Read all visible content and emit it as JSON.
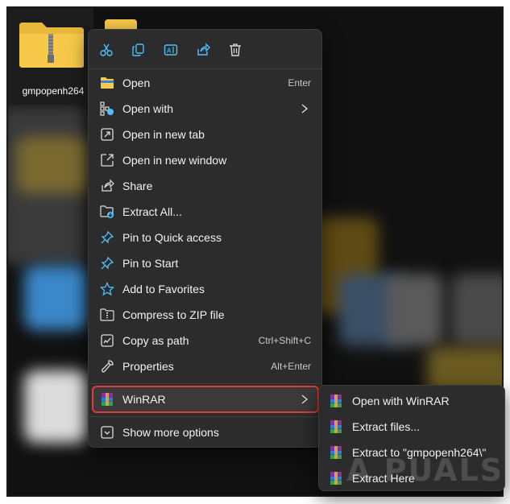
{
  "desktop_file": {
    "name": "gmpopenh264"
  },
  "quick_actions": [
    {
      "icon": "cut-icon"
    },
    {
      "icon": "copy-icon"
    },
    {
      "icon": "rename-icon"
    },
    {
      "icon": "share-icon"
    },
    {
      "icon": "delete-icon"
    }
  ],
  "menu": {
    "items": [
      {
        "label": "Open",
        "shortcut": "Enter",
        "icon": "folder-open-icon"
      },
      {
        "label": "Open with",
        "shortcut": "",
        "icon": "open-with-icon",
        "submenu": true
      },
      {
        "label": "Open in new tab",
        "shortcut": "",
        "icon": "new-tab-icon"
      },
      {
        "label": "Open in new window",
        "shortcut": "",
        "icon": "new-window-icon"
      },
      {
        "label": "Share",
        "shortcut": "",
        "icon": "share-icon"
      },
      {
        "label": "Extract All...",
        "shortcut": "",
        "icon": "extract-all-icon"
      },
      {
        "label": "Pin to Quick access",
        "shortcut": "",
        "icon": "pin-icon"
      },
      {
        "label": "Pin to Start",
        "shortcut": "",
        "icon": "pin-icon"
      },
      {
        "label": "Add to Favorites",
        "shortcut": "",
        "icon": "star-icon"
      },
      {
        "label": "Compress to ZIP file",
        "shortcut": "",
        "icon": "zip-icon"
      },
      {
        "label": "Copy as path",
        "shortcut": "Ctrl+Shift+C",
        "icon": "copy-path-icon"
      },
      {
        "label": "Properties",
        "shortcut": "Alt+Enter",
        "icon": "wrench-icon"
      }
    ],
    "winrar": {
      "label": "WinRAR",
      "icon": "winrar-icon"
    },
    "more": {
      "label": "Show more options",
      "icon": "show-more-icon"
    }
  },
  "submenu": {
    "items": [
      {
        "label": "Open with WinRAR"
      },
      {
        "label": "Extract files..."
      },
      {
        "label": "Extract to \"gmpopenh264\\\""
      },
      {
        "label": "Extract Here"
      }
    ]
  },
  "watermark": "A  PUALS",
  "colors": {
    "menu_bg": "#2c2c2c",
    "highlight_border": "#e23b3b",
    "accent_blue": "#4cc2ff",
    "folder_yellow": "#f6c94a"
  }
}
